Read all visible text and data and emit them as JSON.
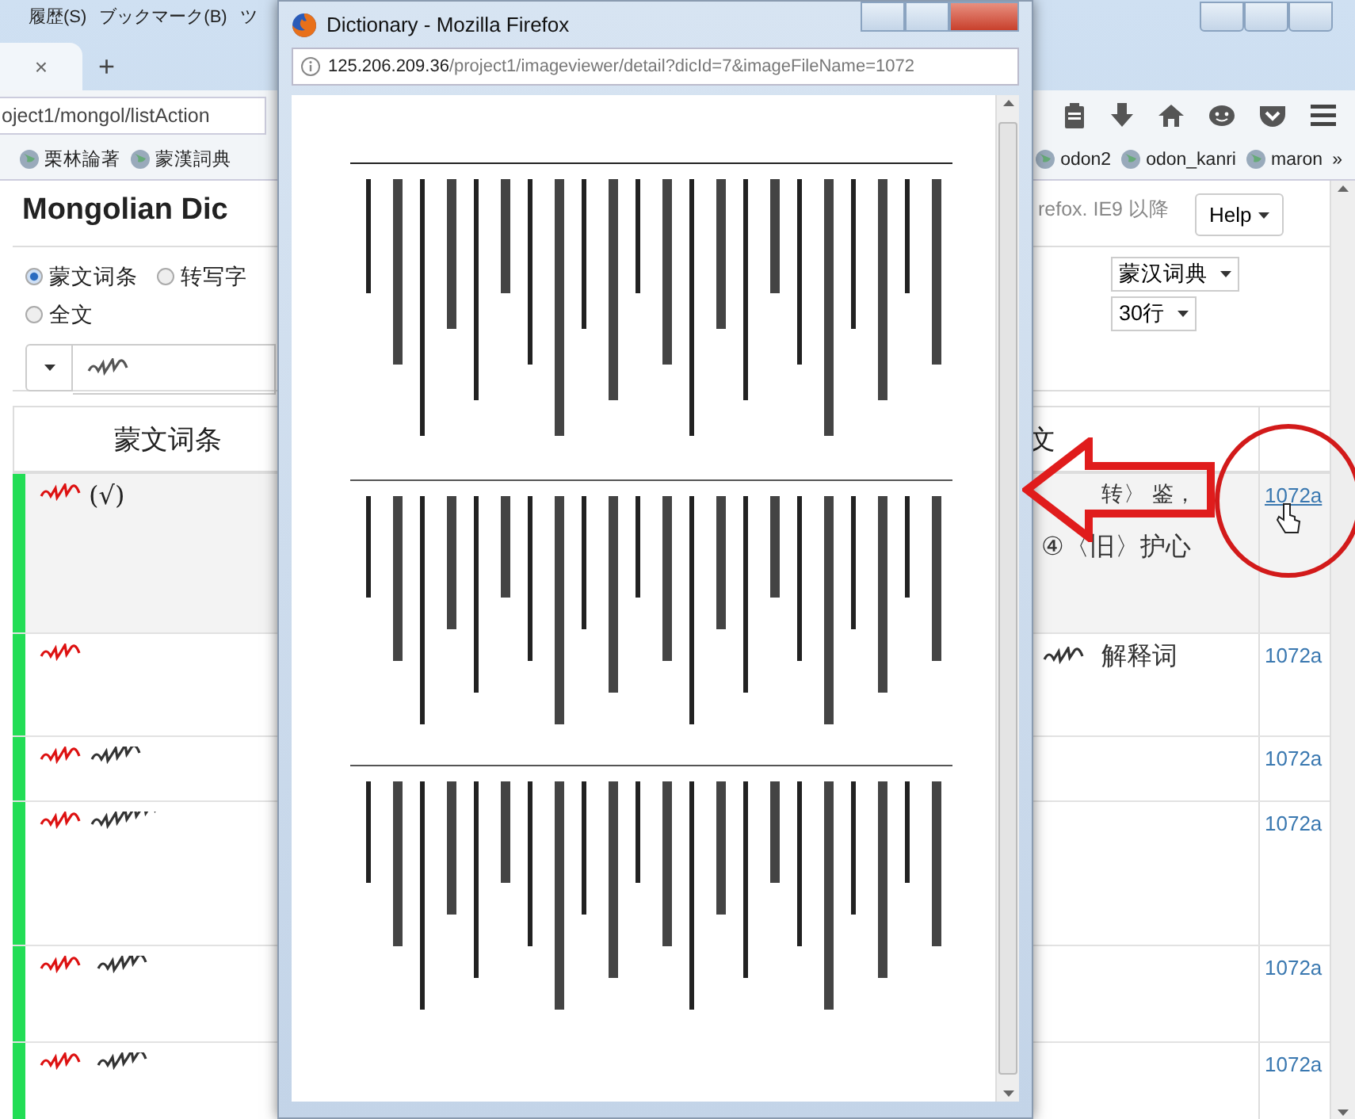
{
  "main_window": {
    "menu": [
      "履歴(S)",
      "ブックマーク(B)",
      "ツ"
    ],
    "tab": {
      "close": "×"
    },
    "new_tab": "+",
    "url": "oject1/mongol/listAction",
    "bookmarks": [
      "栗林論著",
      "蒙漢詞典",
      "odon2",
      "odon_kanri",
      "maron"
    ],
    "bookmarks_more": "»",
    "page": {
      "title": "Mongolian Dic",
      "notice": "refox. IE9 以降",
      "help": "Help",
      "search_modes": [
        {
          "label": "蒙文词条",
          "selected": true
        },
        {
          "label": "转写字",
          "selected": false
        },
        {
          "label": "全文",
          "selected": false
        }
      ],
      "dictionary_select": "蒙汉词典",
      "rows_select": "30行",
      "table": {
        "columns": [
          "蒙文词条",
          "文"
        ],
        "rows": [
          {
            "headword_mark": "(√)",
            "meaning": [
              "转〉 鉴，",
              "④〈旧〉护心"
            ],
            "page": "1072a",
            "highlighted": true,
            "hovered": true
          },
          {
            "meaning": [
              "解释词"
            ],
            "page": "1072a",
            "highlighted": false,
            "hovered": false
          },
          {
            "page": "1072a",
            "highlighted": false,
            "hovered": false
          },
          {
            "page": "1072a",
            "highlighted": false,
            "hovered": false
          },
          {
            "page": "1072a",
            "highlighted": false,
            "hovered": false
          },
          {
            "page": "1072a",
            "highlighted": false,
            "hovered": false
          }
        ]
      }
    }
  },
  "popup_window": {
    "title": "Dictionary - Mozilla Firefox",
    "url_host": "125.206.209.36",
    "url_path": "/project1/imageviewer/detail?dicId=7&imageFileName=1072"
  }
}
